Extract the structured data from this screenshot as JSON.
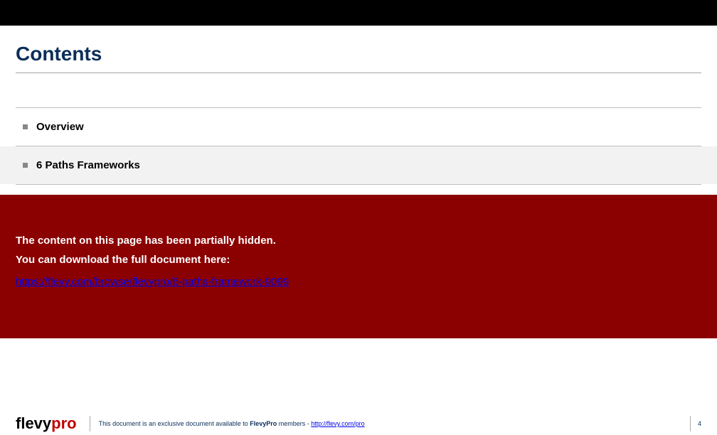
{
  "title": "Contents",
  "items": [
    {
      "label": "Overview",
      "shaded": false
    },
    {
      "label": "6 Paths Frameworks",
      "shaded": true
    }
  ],
  "hidden": {
    "line1": "The content on this page has been partially hidden.",
    "line2": "You can download the full document here:",
    "url": "https://flevy.com/browse/flevypro/6-paths-framework-9099"
  },
  "footer": {
    "logo_flevy": "flevy",
    "logo_pro": "pro",
    "text_pre": "This document is an exclusive document available to ",
    "text_bold": "FlevyPro",
    "text_mid": " members - ",
    "text_link": "http://flevy.com/pro",
    "page": "4"
  }
}
